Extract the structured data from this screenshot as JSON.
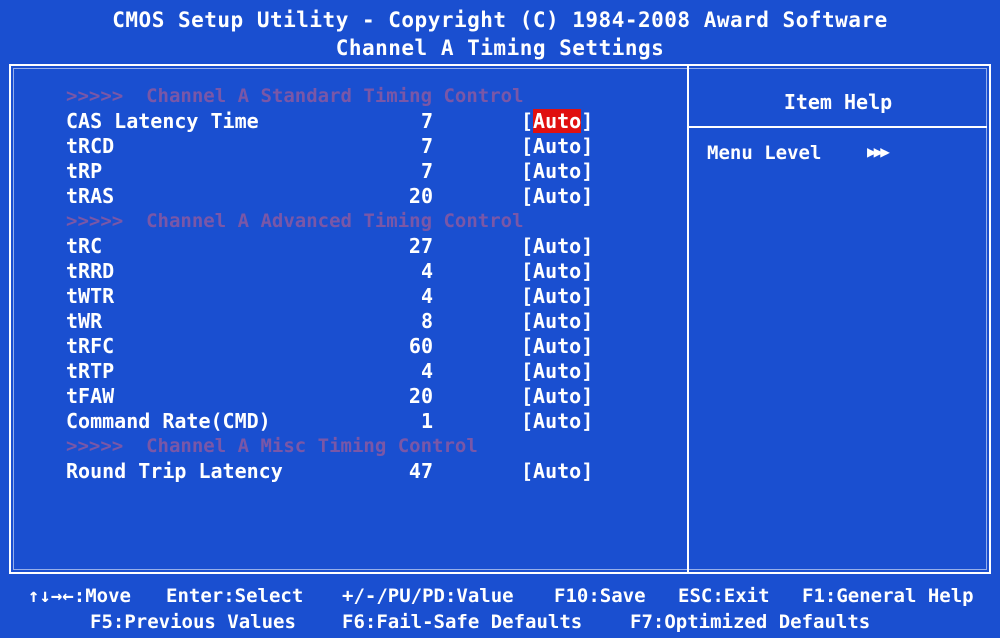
{
  "header": {
    "title": "CMOS Setup Utility - Copyright (C) 1984-2008 Award Software",
    "subtitle": "Channel A Timing Settings"
  },
  "settings": [
    {
      "type": "section",
      "label": ">>>>>  Channel A Standard Timing Control"
    },
    {
      "type": "item",
      "name": "CAS Latency Time",
      "value": "7",
      "option_open": "[",
      "option": "Auto",
      "option_close": "]",
      "selected": true
    },
    {
      "type": "item",
      "name": "tRCD",
      "value": "7",
      "option_open": "[",
      "option": "Auto",
      "option_close": "]",
      "selected": false
    },
    {
      "type": "item",
      "name": "tRP",
      "value": "7",
      "option_open": "[",
      "option": "Auto",
      "option_close": "]",
      "selected": false
    },
    {
      "type": "item",
      "name": "tRAS",
      "value": "20",
      "option_open": "[",
      "option": "Auto",
      "option_close": "]",
      "selected": false
    },
    {
      "type": "section",
      "label": ">>>>>  Channel A Advanced Timing Control"
    },
    {
      "type": "item",
      "name": "tRC",
      "value": "27",
      "option_open": "[",
      "option": "Auto",
      "option_close": "]",
      "selected": false
    },
    {
      "type": "item",
      "name": "tRRD",
      "value": "4",
      "option_open": "[",
      "option": "Auto",
      "option_close": "]",
      "selected": false
    },
    {
      "type": "item",
      "name": "tWTR",
      "value": "4",
      "option_open": "[",
      "option": "Auto",
      "option_close": "]",
      "selected": false
    },
    {
      "type": "item",
      "name": "tWR",
      "value": "8",
      "option_open": "[",
      "option": "Auto",
      "option_close": "]",
      "selected": false
    },
    {
      "type": "item",
      "name": "tRFC",
      "value": "60",
      "option_open": "[",
      "option": "Auto",
      "option_close": "]",
      "selected": false
    },
    {
      "type": "item",
      "name": "tRTP",
      "value": "4",
      "option_open": "[",
      "option": "Auto",
      "option_close": "]",
      "selected": false
    },
    {
      "type": "item",
      "name": "tFAW",
      "value": "20",
      "option_open": "[",
      "option": "Auto",
      "option_close": "]",
      "selected": false
    },
    {
      "type": "item",
      "name": "Command Rate(CMD)",
      "value": "1",
      "option_open": "[",
      "option": "Auto",
      "option_close": "]",
      "selected": false
    },
    {
      "type": "section",
      "label": ">>>>>  Channel A Misc Timing Control"
    },
    {
      "type": "item",
      "name": "Round Trip Latency",
      "value": "47",
      "option_open": "[",
      "option": "Auto",
      "option_close": "]",
      "selected": false
    }
  ],
  "help": {
    "title": "Item Help",
    "menu_level_label": "Menu Level",
    "menu_level_arrows": "▶▶▶"
  },
  "footer": {
    "line1": [
      "↑↓→←:Move",
      "Enter:Select",
      "+/-/PU/PD:Value",
      "F10:Save",
      "ESC:Exit",
      "F1:General Help"
    ],
    "line2": [
      "F5:Previous Values",
      "F6:Fail-Safe Defaults",
      "F7:Optimized Defaults"
    ]
  },
  "colors": {
    "background": "#1a4fd0",
    "text": "#ffffff",
    "highlight": "#e01010",
    "section_text": "#9a5a9a"
  }
}
